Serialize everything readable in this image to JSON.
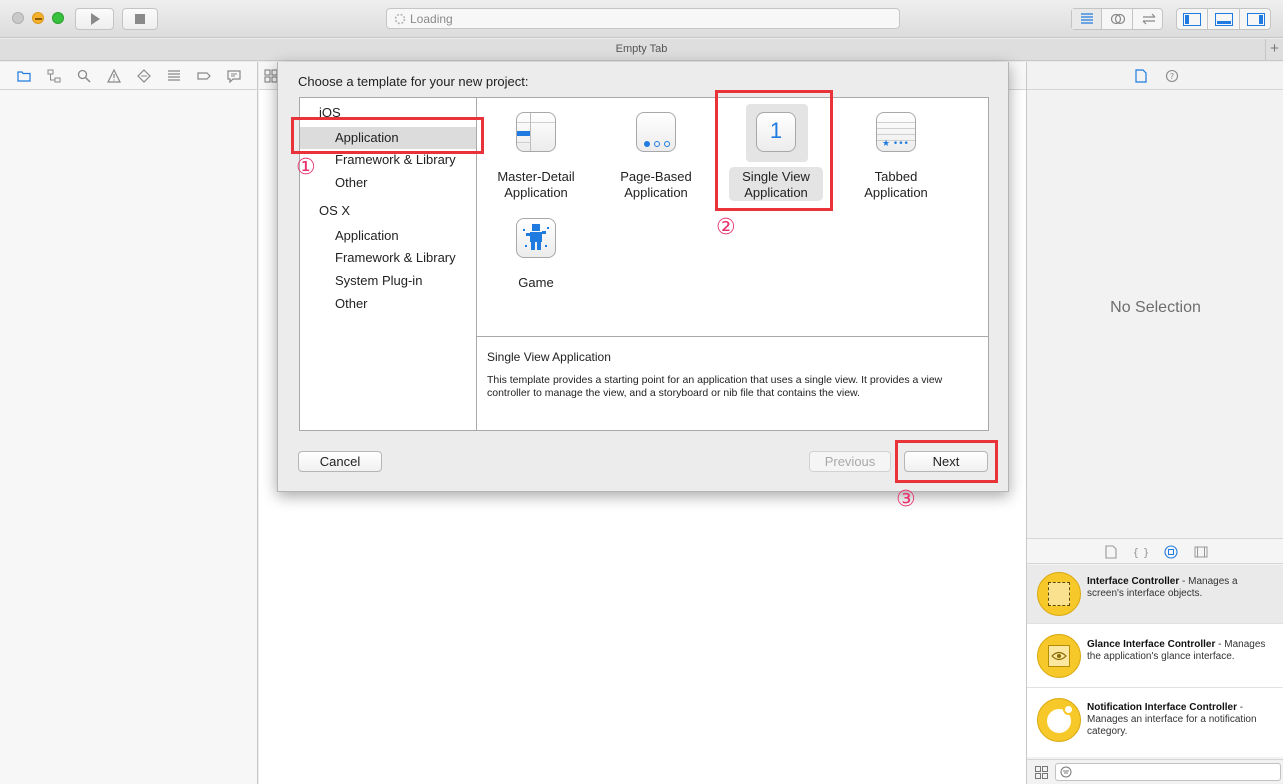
{
  "toolbar": {
    "activity_text": "Loading",
    "icons": [
      "close-light",
      "minimize-light",
      "zoom-light",
      "run-icon",
      "stop-icon",
      "standard-editor-icon",
      "assistant-editor-icon",
      "version-editor-icon",
      "navigator-toggle-icon",
      "debug-toggle-icon",
      "utilities-toggle-icon"
    ]
  },
  "tabbar": {
    "title": "Empty Tab",
    "add_label": "+"
  },
  "sheet": {
    "title": "Choose a template for your new project:",
    "categories": [
      {
        "label": "iOS"
      },
      {
        "label": "Application",
        "selected": true
      },
      {
        "label": "Framework & Library"
      },
      {
        "label": "Other"
      },
      {
        "label": "OS X"
      },
      {
        "label": "Application"
      },
      {
        "label": "Framework & Library"
      },
      {
        "label": "System Plug-in"
      },
      {
        "label": "Other"
      }
    ],
    "templates": [
      {
        "label": "Master-Detail\nApplication",
        "icon": "master-detail-icon"
      },
      {
        "label": "Page-Based\nApplication",
        "icon": "page-based-icon"
      },
      {
        "label": "Single View\nApplication",
        "icon": "single-view-icon",
        "icon_text": "1",
        "selected": true
      },
      {
        "label": "Tabbed\nApplication",
        "icon": "tabbed-icon"
      },
      {
        "label": "Game",
        "icon": "game-icon"
      }
    ],
    "description_title": "Single View Application",
    "description_body": "This template provides a starting point for an application that uses a single view. It provides a view controller to manage the view, and a storyboard or nib file that contains the view.",
    "buttons": {
      "cancel": "Cancel",
      "previous": "Previous",
      "next": "Next"
    }
  },
  "inspector": {
    "no_selection": "No Selection"
  },
  "library": {
    "items": [
      {
        "title": "Interface Controller",
        "desc": " - Manages a screen's interface objects.",
        "icon": "interface-controller-icon"
      },
      {
        "title": "Glance Interface Controller",
        "desc": " - Manages the application's glance interface.",
        "icon": "glance-controller-icon"
      },
      {
        "title": "Notification Interface Controller",
        "desc": " - Manages an interface for a notification category.",
        "icon": "notification-controller-icon"
      }
    ]
  },
  "annotations": {
    "step1": "①",
    "step2": "②",
    "step3": "③"
  },
  "colors": {
    "annotation_red": "#e8333b",
    "annotation_pink": "#e8336e",
    "accent_blue": "#1f7be0",
    "library_icon_yellow": "#f6c829"
  }
}
